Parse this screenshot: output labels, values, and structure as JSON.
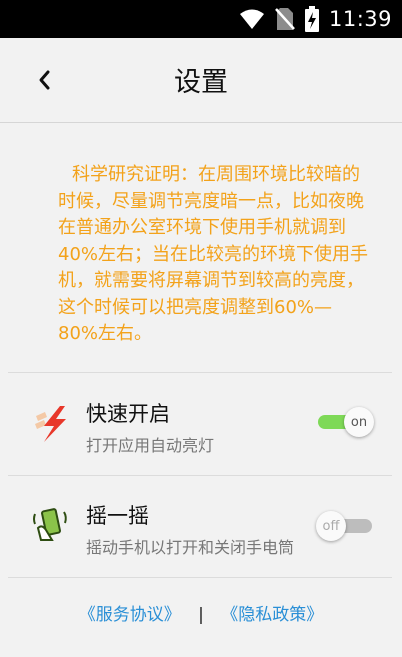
{
  "status_bar": {
    "time": "11:39",
    "icons": [
      "wifi-icon",
      "no-sim-icon",
      "battery-charging-icon"
    ]
  },
  "header": {
    "title": "设置",
    "back_icon": "chevron-left-icon"
  },
  "info": {
    "lines": [
      "科学研究证明：在周围环境比较",
      "暗的时候，尽量调节亮度暗一点，比",
      "如夜晚在普通办公室环境下使用手机",
      "就调到40%左右；当在比较亮的环境",
      "下使用手机，就需要将屏幕调节到较",
      "高的亮度，这个时候可以把亮度调整",
      "到60%—80%左右。"
    ],
    "color": "#f3a21a"
  },
  "settings": [
    {
      "icon": "lightning-icon",
      "title": "快速开启",
      "subtitle": "打开应用自动亮灯",
      "toggle": {
        "state": "on",
        "label": "on",
        "color": "#7ed957"
      }
    },
    {
      "icon": "shake-phone-icon",
      "title": "摇一摇",
      "subtitle": "摇动手机以打开和关闭手电筒",
      "toggle": {
        "state": "off",
        "label": "off",
        "color": "#bdbdbd"
      }
    }
  ],
  "footer": {
    "service_link": "《服务协议》",
    "separator": "|",
    "privacy_link": "《隐私政策》",
    "link_color": "#2a8fd6"
  }
}
